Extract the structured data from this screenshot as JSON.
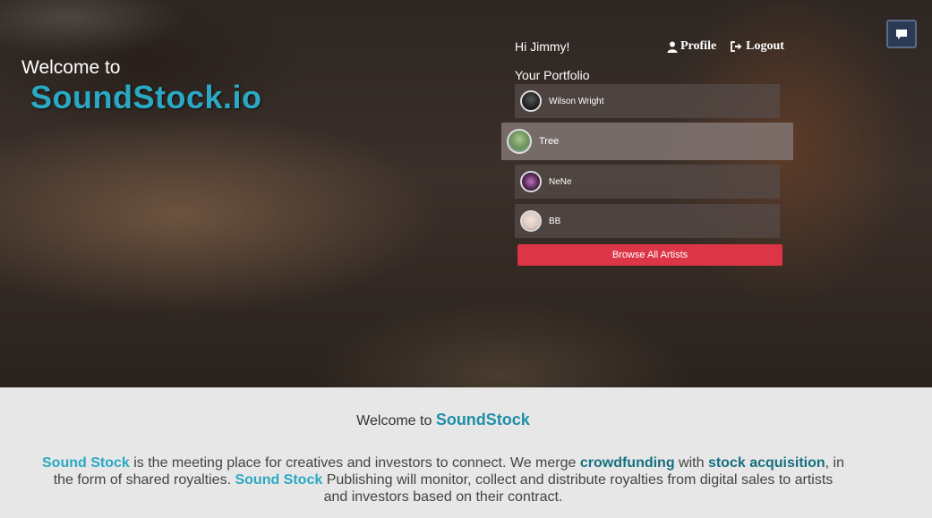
{
  "hero": {
    "welcome_small": "Welcome to",
    "brand": "SoundStock.io"
  },
  "header": {
    "greeting": "Hi Jimmy!",
    "profile_label": "Profile",
    "logout_label": "Logout"
  },
  "portfolio": {
    "title": "Your Portfolio",
    "artists": [
      {
        "name": "Wilson Wright",
        "avatar_color": "#1b1b1b"
      },
      {
        "name": "Tree",
        "avatar_color": "#7ea36b"
      },
      {
        "name": "NeNe",
        "avatar_color": "#3a1a3a"
      },
      {
        "name": "BB",
        "avatar_color": "#d9c9bf"
      }
    ],
    "active_index": 1,
    "browse_label": "Browse All Artists"
  },
  "about": {
    "heading_prefix": "Welcome to",
    "heading_brand": "SoundStock",
    "p_brand1": "Sound Stock",
    "p_text1": " is the meeting place for creatives and investors to connect. We merge ",
    "p_term1": "crowdfunding",
    "p_text2": " with ",
    "p_term2": "stock acquisition",
    "p_text3": ", in the form of shared royalties. ",
    "p_brand2": "Sound Stock",
    "p_text4": " Publishing will monitor, collect and distribute royalties from digital sales to artists and investors based on their contract."
  },
  "colors": {
    "brand_accent": "#2aa9c4",
    "term_accent": "#16707f",
    "browse_button": "#dc3545",
    "chat_button": "#2d3a55"
  },
  "icons": {
    "profile": "user-icon",
    "logout": "sign-out-icon",
    "chat": "chat-bubble-icon"
  }
}
